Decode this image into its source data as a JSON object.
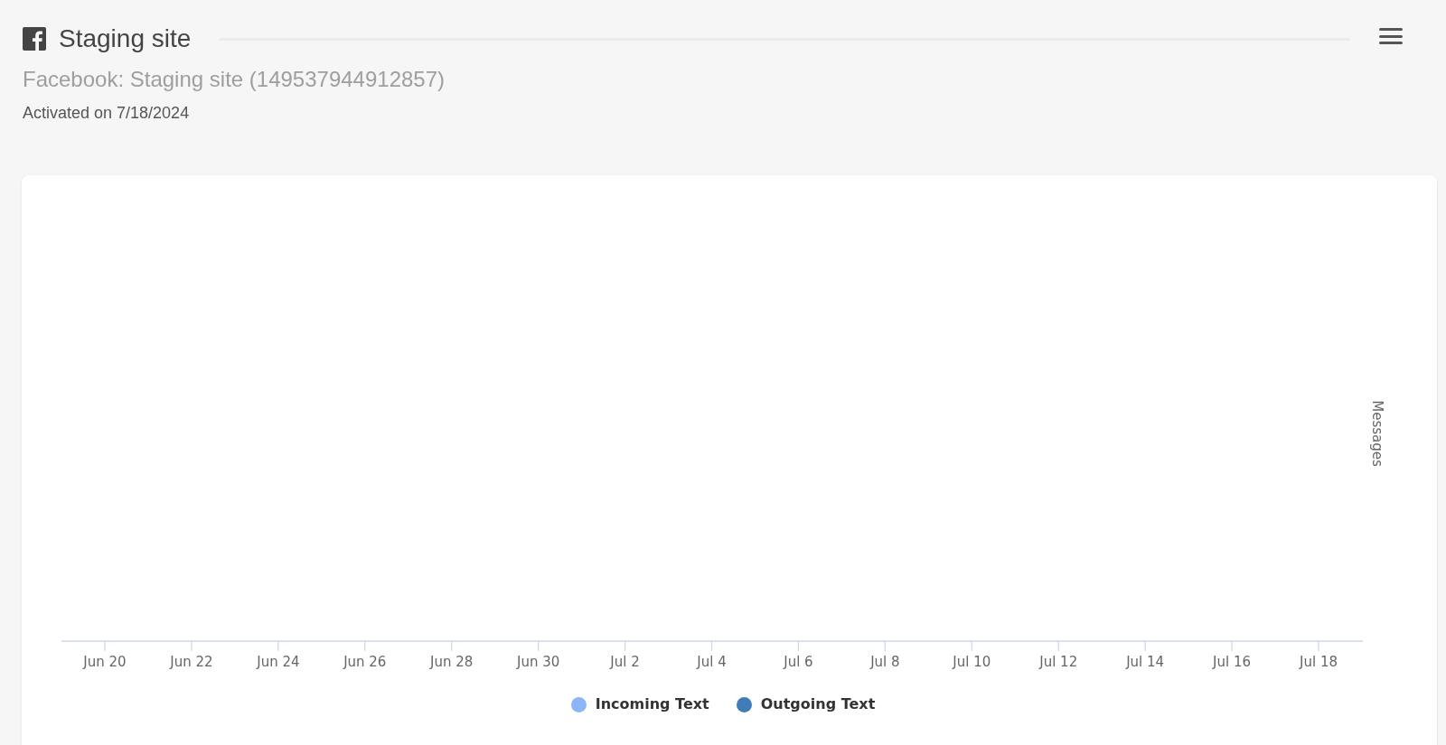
{
  "header": {
    "title": "Staging site",
    "subtitle": "Facebook: Staging site (149537944912857)",
    "activated": "Activated on 7/18/2024"
  },
  "chart": {
    "y_title": "Messages",
    "x_labels": [
      "Jun 20",
      "Jun 22",
      "Jun 24",
      "Jun 26",
      "Jun 28",
      "Jun 30",
      "Jul 2",
      "Jul 4",
      "Jul 6",
      "Jul 8",
      "Jul 10",
      "Jul 12",
      "Jul 14",
      "Jul 16",
      "Jul 18"
    ],
    "legend": [
      {
        "label": "Incoming Text",
        "color": "#8cb6f5"
      },
      {
        "label": "Outgoing Text",
        "color": "#3f7cb8"
      }
    ]
  }
}
